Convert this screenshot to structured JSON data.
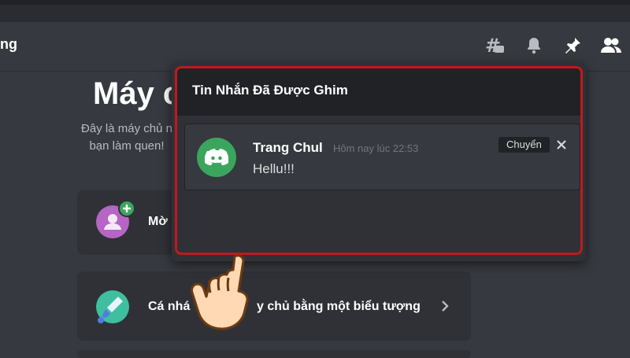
{
  "header": {
    "channel_name": "ng",
    "icons": [
      "threads-icon",
      "bell-icon",
      "pin-icon",
      "members-icon"
    ]
  },
  "welcome": {
    "title": "Máy c",
    "desc_line1": "Đây là máy chủ n",
    "desc_line2": "bạn làm quen!"
  },
  "cards": {
    "invite_label": "Mờ",
    "icon_label": "Cá nhân hóa máy chủ bằng một biểu tượng",
    "icon_label_visible_part1": "Cá nhá",
    "icon_label_visible_part2": "y chủ bằng một biểu tượng"
  },
  "pinned": {
    "title": "Tin Nhắn Đã Được Ghim",
    "message": {
      "author": "Trang Chul",
      "timestamp": "Hôm nay lúc 22:53",
      "text": "Hellu!!!",
      "jump_label": "Chuyển"
    }
  },
  "colors": {
    "background": "#36393f",
    "popout": "#2f3136",
    "highlight": "#c0191d",
    "discord_green": "#3ba55d"
  }
}
